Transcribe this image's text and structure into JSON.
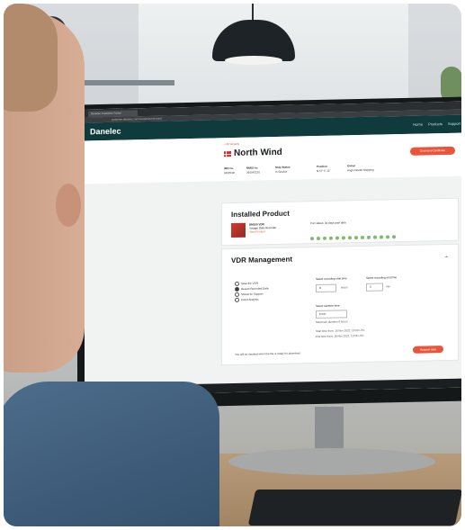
{
  "browser": {
    "tab_title": "Danelec Customer Portal",
    "url": "customer.danelec.com/vessels/north-wind"
  },
  "portal": {
    "logo": "Danelec",
    "nav": [
      "Home",
      "Products",
      "Support"
    ]
  },
  "vessel": {
    "breadcrumb": "< All Vessels",
    "name": "North Wind",
    "primary_button": "Download Certificate",
    "meta": [
      {
        "label": "IMO no.",
        "value": "9432018"
      },
      {
        "label": "MMSI no.",
        "value": "265543210"
      },
      {
        "label": "Ship Status",
        "value": "In Service"
      },
      {
        "label": "Position",
        "value": "N 57°  E 11°"
      },
      {
        "label": "Owner",
        "value": "Anglo Nordic Shipping"
      }
    ]
  },
  "installed": {
    "title": "Installed Product",
    "product_name": "DM100 VDR",
    "product_desc": "Voyage Data Recorder",
    "product_link": "View Product",
    "status_text": "Port status: 30 days past data",
    "dot_count": 14
  },
  "vdr": {
    "title": "VDR Management",
    "options": [
      {
        "label": "Save the VDR",
        "selected": false
      },
      {
        "label": "Recent Recorded Data",
        "selected": true
      },
      {
        "label": "Stored for Support",
        "selected": false
      },
      {
        "label": "Event Analysis",
        "selected": false
      }
    ],
    "start_label": "Select recording start time",
    "end_label": "Select recording end time",
    "start_value": "8",
    "start_unit": "hours",
    "end_value": "0",
    "end_unit": "min",
    "dur_label": "Select duration time",
    "dur_value": "6 min",
    "dur_note": "Maximum duration 6 hours",
    "start_time_line": "Start time from: 16 Nov 2022, 13:00 UTC",
    "end_time_line": "End time from: 16 Nov 2022, 13:06 UTC",
    "footnote": "You will be emailed when the file is ready for download",
    "export_button": "Request data"
  }
}
